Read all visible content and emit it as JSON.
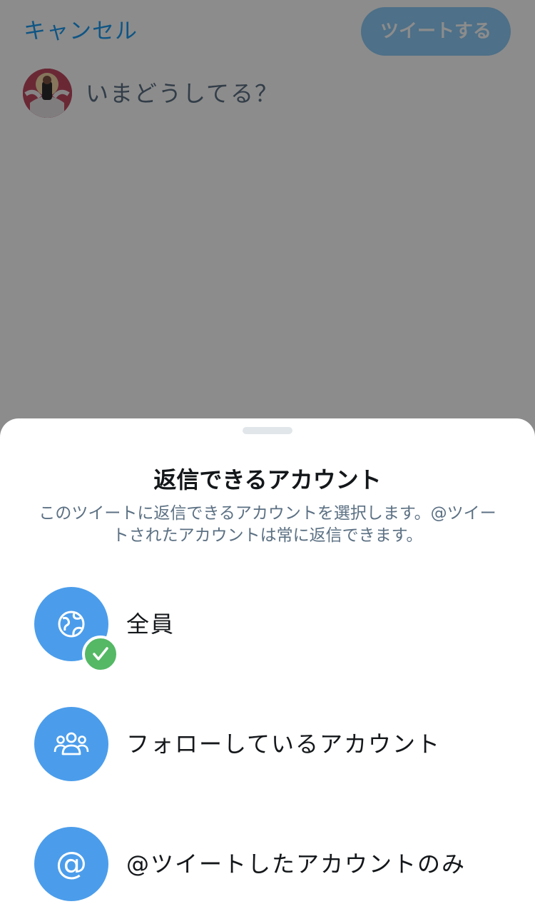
{
  "compose": {
    "cancel_label": "キャンセル",
    "tweet_label": "ツイートする",
    "placeholder": "いまどうしてる？"
  },
  "sheet": {
    "title": "返信できるアカウント",
    "description": "このツイートに返信できるアカウントを選択します。@ツイートされたアカウントは常に返信できます。",
    "options": [
      {
        "label": "全員",
        "icon": "globe-icon",
        "selected": true
      },
      {
        "label": "フォローしているアカウント",
        "icon": "people-icon",
        "selected": false
      },
      {
        "label": "@ツイートしたアカウントのみ",
        "icon": "at-sign-icon",
        "selected": false
      }
    ]
  },
  "colors": {
    "accent": "#1d9bf0",
    "option_circle": "#4b9deb",
    "check": "#54b865",
    "overlay": "rgba(0,0,0,0.45)"
  }
}
